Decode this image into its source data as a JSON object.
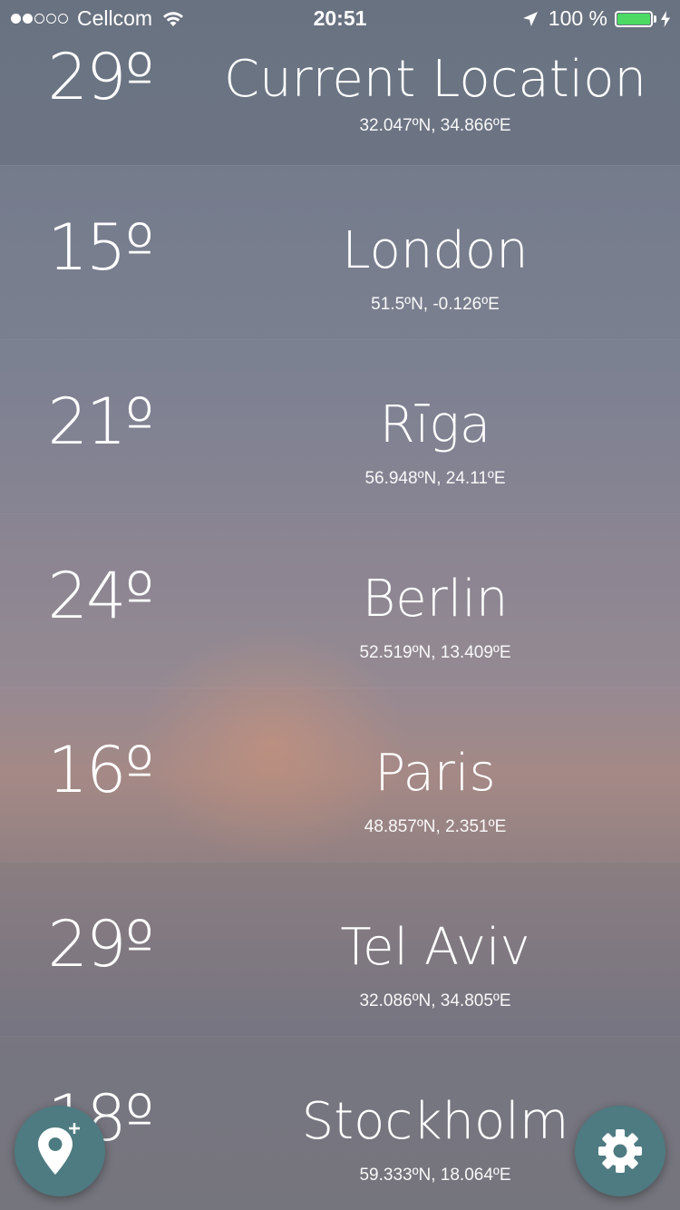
{
  "status_bar": {
    "signal_bars_filled": 2,
    "signal_bars_total": 5,
    "carrier": "Cellcom",
    "time": "20:51",
    "battery_text": "100 %",
    "battery_level": 1.0,
    "battery_color": "#4cd964"
  },
  "cities": [
    {
      "temp": "29º",
      "name": "Current Location",
      "coords": "32.047ºN, 34.866ºE"
    },
    {
      "temp": "15º",
      "name": "London",
      "coords": "51.5ºN, -0.126ºE"
    },
    {
      "temp": "21º",
      "name": "Rīga",
      "coords": "56.948ºN, 24.11ºE"
    },
    {
      "temp": "24º",
      "name": "Berlin",
      "coords": "52.519ºN, 13.409ºE"
    },
    {
      "temp": "16º",
      "name": "Paris",
      "coords": "48.857ºN, 2.351ºE"
    },
    {
      "temp": "29º",
      "name": "Tel Aviv",
      "coords": "32.086ºN, 34.805ºE"
    },
    {
      "temp": "18º",
      "name": "Stockholm",
      "coords": "59.333ºN, 18.064ºE"
    }
  ],
  "buttons": {
    "add_location_icon": "map-pin-plus-icon",
    "settings_icon": "gear-icon",
    "accent_color": "#4e7b81"
  }
}
